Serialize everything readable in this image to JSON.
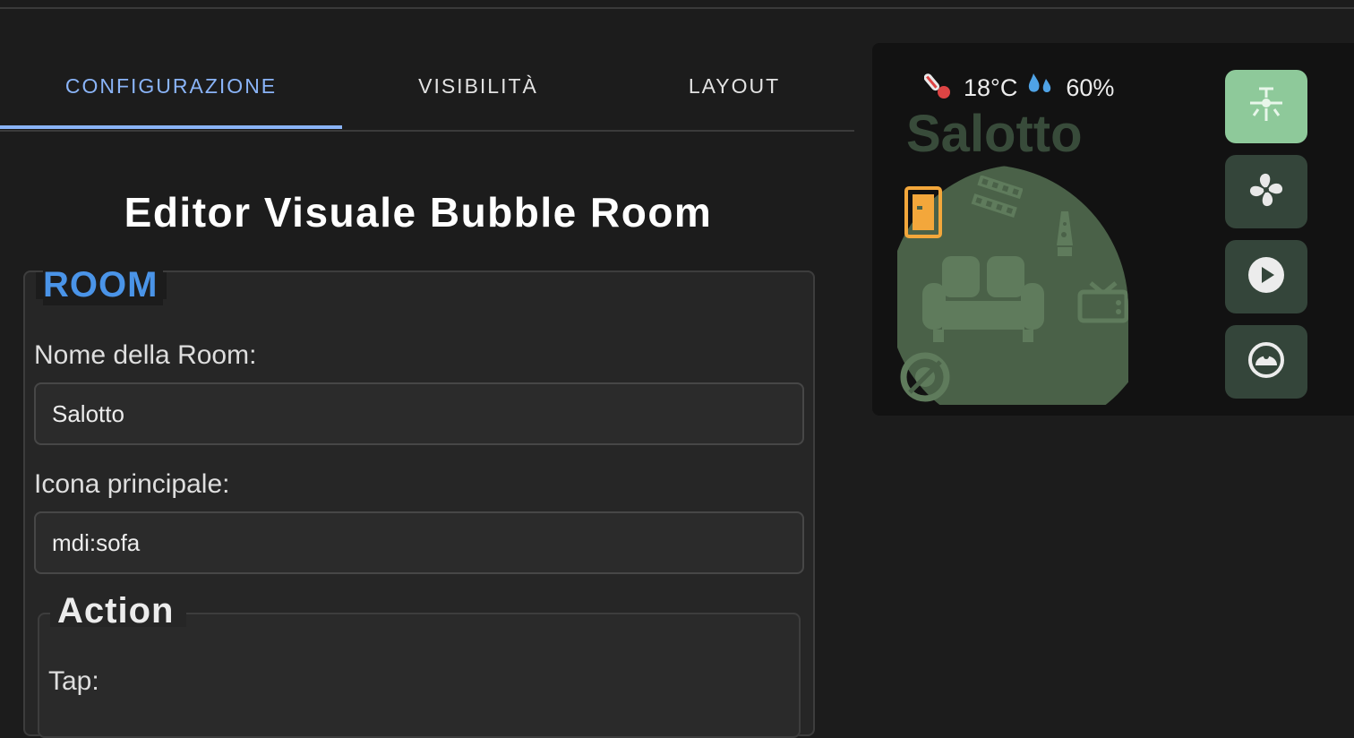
{
  "tabs": [
    {
      "label": "CONFIGURAZIONE",
      "active": true
    },
    {
      "label": "VISIBILITÀ",
      "active": false
    },
    {
      "label": "LAYOUT",
      "active": false
    }
  ],
  "editor": {
    "title": "Editor Visuale Bubble Room",
    "room_section": {
      "legend": "ROOM",
      "name_label": "Nome della Room:",
      "name_value": "Salotto",
      "icon_label": "Icona principale:",
      "icon_value": "mdi:sofa"
    },
    "action_section": {
      "legend": "Action",
      "tap_label": "Tap:"
    }
  },
  "preview": {
    "temperature": "18°C",
    "humidity": "60%",
    "room_name": "Salotto",
    "main_icon": "sofa-icon",
    "sub_icons": [
      "door-icon",
      "film-strip-icon",
      "lava-lamp-icon",
      "tv-icon",
      "robot-vacuum-icon"
    ],
    "side_buttons": [
      {
        "icon": "ceiling-fan-light-icon",
        "active": true
      },
      {
        "icon": "fan-icon",
        "active": false
      },
      {
        "icon": "play-icon",
        "active": false
      },
      {
        "icon": "robot-icon",
        "active": false
      }
    ]
  },
  "colors": {
    "accent_blue": "#8ab4f8",
    "room_legend": "#4a94e8",
    "active_button": "#8ec99a",
    "button": "#34453a",
    "bubble": "#4a6148",
    "door_icon": "#f3a73b"
  }
}
